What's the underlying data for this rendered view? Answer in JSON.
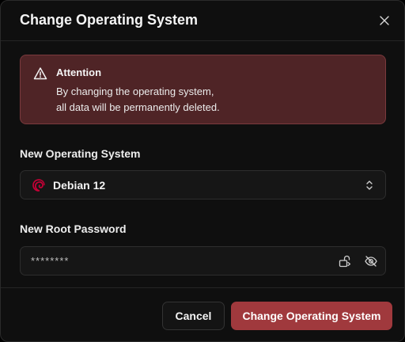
{
  "dialog": {
    "title": "Change Operating System",
    "close_icon": "close-icon"
  },
  "alert": {
    "icon": "warning-triangle-icon",
    "title": "Attention",
    "line1": "By changing the operating system,",
    "line2": "all data will be permanently deleted.",
    "background": "#4f2426",
    "border": "#7a3a3d"
  },
  "os_field": {
    "label": "New Operating System",
    "selected": "Debian 12",
    "logo_icon": "debian-logo-icon",
    "logo_color": "#c70036"
  },
  "password_field": {
    "label": "New Root Password",
    "value": "********",
    "generate_icon": "generate-password-icon",
    "visibility_icon": "eye-off-icon"
  },
  "actions": {
    "cancel_label": "Cancel",
    "confirm_label": "Change Operating System",
    "confirm_color": "#a0393d"
  }
}
